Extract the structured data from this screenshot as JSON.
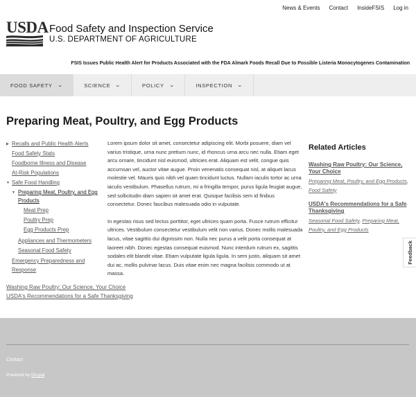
{
  "utility_nav": [
    "News & Events",
    "Contact",
    "InsideFSIS",
    "Log in"
  ],
  "brand": {
    "logo_text": "USDA",
    "name": "Food Safety and Inspection Service",
    "dept": "U.S. DEPARTMENT OF AGRICULTURE"
  },
  "alert": "FSIS Issues Public Health Alert for Products Associated with the FDA Almark Foods Recall Due to Possible Listeria Monocytogenes Contamination",
  "main_nav": [
    {
      "label": "FOOD SAFETY",
      "active": true
    },
    {
      "label": "SCIENCE",
      "active": false
    },
    {
      "label": "POLICY",
      "active": false
    },
    {
      "label": "INSPECTION",
      "active": false
    }
  ],
  "page_title": "Preparing Meat, Poultry, and Egg Products",
  "sidenav": [
    {
      "label": "Recalls and Public Health Alerts",
      "level": 0,
      "bullet": "collapsed"
    },
    {
      "label": "Food Safety Stats",
      "level": 0,
      "bullet": ""
    },
    {
      "label": "Foodborne Illness and Disease",
      "level": 0,
      "bullet": ""
    },
    {
      "label": "At-Risk Populations",
      "level": 0,
      "bullet": ""
    },
    {
      "label": "Safe Food Handling",
      "level": 0,
      "bullet": "expanded"
    },
    {
      "label": "Preparing Meat, Poultry, and Egg Products",
      "level": 1,
      "bullet": "expanded",
      "current": true
    },
    {
      "label": "Meat Prep",
      "level": 2,
      "bullet": ""
    },
    {
      "label": "Poultry Prep",
      "level": 2,
      "bullet": ""
    },
    {
      "label": "Egg Products Prep",
      "level": 2,
      "bullet": ""
    },
    {
      "label": "Appliances and Thermometers",
      "level": 1,
      "bullet": ""
    },
    {
      "label": "Seasonal Food Safety",
      "level": 1,
      "bullet": ""
    },
    {
      "label": "Emergency Preparedness and Response",
      "level": 0,
      "bullet": ""
    }
  ],
  "bottom_links": [
    "Washing Raw Poultry: Our Science, Your Choice",
    "USDA's Recommendations for a Safe Thanksgiving"
  ],
  "body": [
    "Lorem ipsum dolor sit amet, consectetur adipiscing elit. Morbi posuere, diam vel varius tristique, urna nunc pretium nunc, id rhoncus urna arcu nec nulla. Etiam eget arcu ornare, tincidunt nisl euismod, ultricies erat. Aliquam est velit, congue quis accumsan vel, auctor vitae augue. Proin venenatis consequat nisl, at aliquet lacus molestie vel. Mauris quis nibh vel quam tincidunt luctus. Nullam iaculis tortor ac urna iaculis vestibulum. Phasellus rutrum, mi a fringilla tempor, purus ligula feugiat augue, sed sollicitudin diam sapien sit amet erat. Quisque facilisis sem id finibus consectetur. Donec faucibus malesuada odio in vulputate.",
    "In egestas risus sed lectus porttitor, eget ultrices quam porta. Fusce rutrum efficitur ultrices. Vestibulum consectetur vestibulum velit non varius. Donec mollis malesuada lacus, vitae sagittis dui dignissim non. Nulla nec purus a velit porta consequat at laoreet nibh. Donec egestas consequat euismod. Nunc interdum rutrum ex, sagittis sodales elit blandit vitae. Etiam vulputate ligula ligula. In sem justo, aliquam sit amet dui ac, mollis pulvinar lacus. Duis vitae enim nec magna facilisis commodo ut at massa."
  ],
  "related": {
    "heading": "Related Articles",
    "items": [
      {
        "title": "Washing Raw Poultry: Our Science, Your Choice",
        "tags": [
          "Preparing Meat, Poultry, and Egg Products",
          "Food Safety"
        ]
      },
      {
        "title": "USDA's Recommendations for a Safe Thanksgiving",
        "tags": [
          "Seasonal Food Safety",
          "Preparing Meat, Poultry, and Egg Products"
        ]
      }
    ]
  },
  "feedback": "Feedback",
  "footer": {
    "contact": "Contact",
    "powered_prefix": "Powered by",
    "powered_link": "Drupal"
  }
}
